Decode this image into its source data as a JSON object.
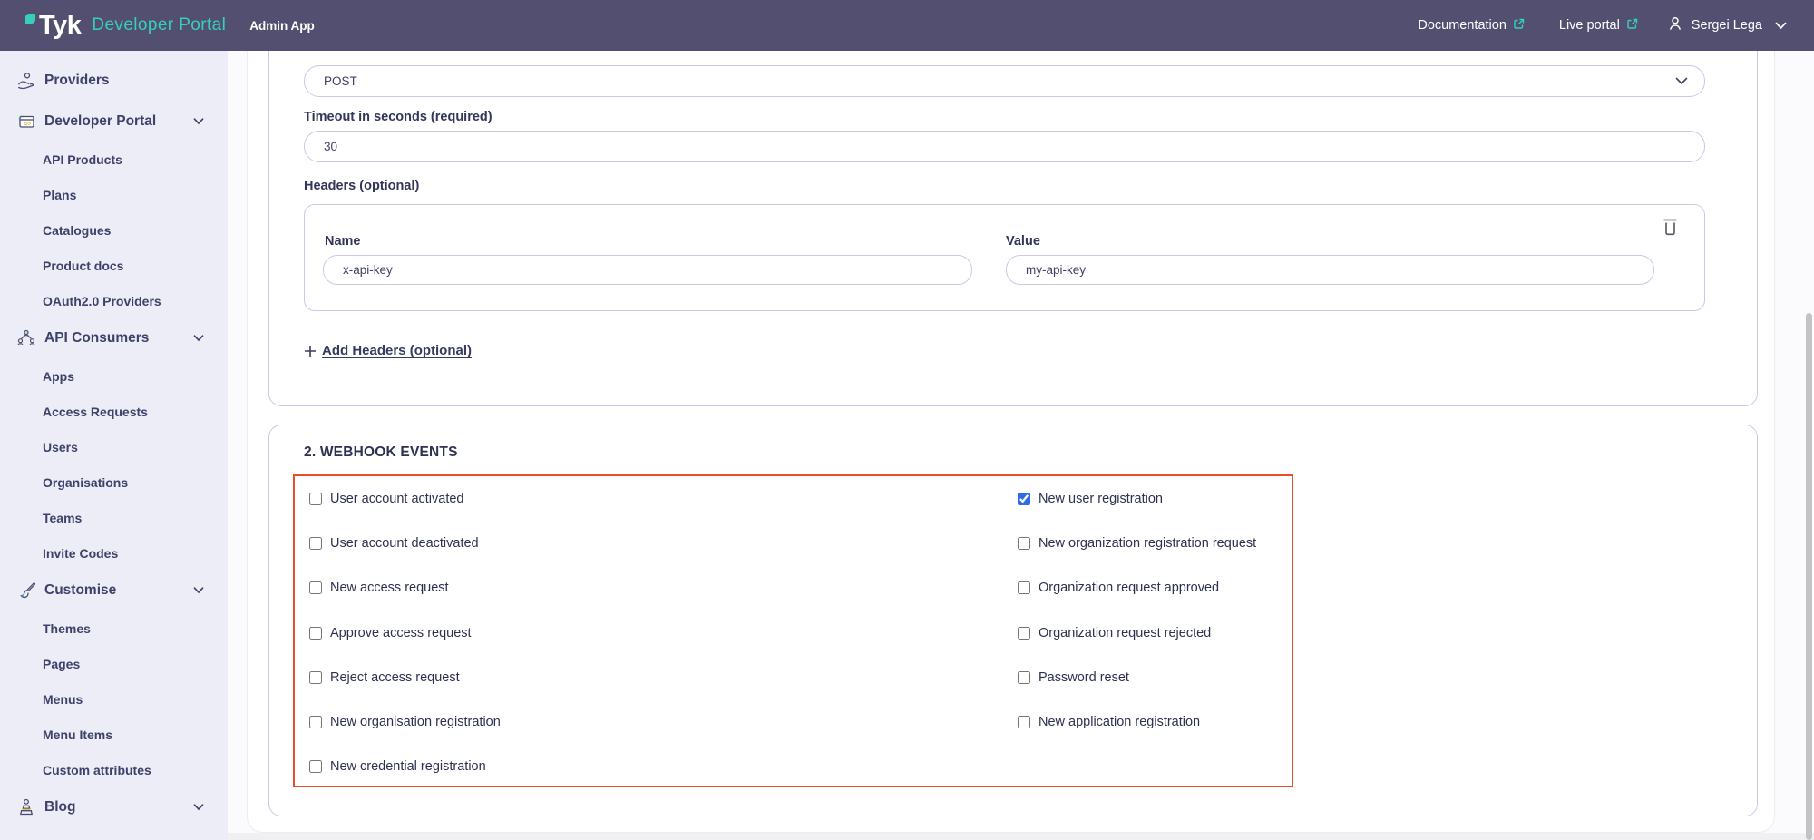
{
  "topbar": {
    "brand": "Tyk",
    "brand_suffix": "Developer Portal",
    "app_label": "Admin App",
    "links": [
      {
        "label": "Documentation",
        "icon": "external-link-icon"
      },
      {
        "label": "Live portal",
        "icon": "external-link-icon"
      }
    ],
    "user": {
      "name": "Sergei Lega"
    }
  },
  "sidebar": {
    "items": [
      {
        "label": "Providers",
        "icon": "provider-icon",
        "expandable": false,
        "children": []
      },
      {
        "label": "Developer Portal",
        "icon": "developer-portal-icon",
        "expandable": true,
        "children": [
          "API Products",
          "Plans",
          "Catalogues",
          "Product docs",
          "OAuth2.0 Providers"
        ]
      },
      {
        "label": "API Consumers",
        "icon": "api-consumers-icon",
        "expandable": true,
        "children": [
          "Apps",
          "Access Requests",
          "Users",
          "Organisations",
          "Teams",
          "Invite Codes"
        ]
      },
      {
        "label": "Customise",
        "icon": "customise-icon",
        "expandable": true,
        "children": [
          "Themes",
          "Pages",
          "Menus",
          "Menu Items",
          "Custom attributes"
        ]
      },
      {
        "label": "Blog",
        "icon": "blog-icon",
        "expandable": true,
        "children": []
      }
    ]
  },
  "form": {
    "method_select": {
      "value": "POST"
    },
    "timeout": {
      "label": "Timeout in seconds (required)",
      "value": "30"
    },
    "headers": {
      "label": "Headers (optional)",
      "row": {
        "name_label": "Name",
        "name_value": "x-api-key",
        "value_label": "Value",
        "value_value": "my-api-key"
      },
      "add_link": "Add Headers (optional)"
    }
  },
  "webhook_events": {
    "heading": "2. WEBHOOK EVENTS",
    "left_column": [
      {
        "label": "User account activated",
        "checked": false
      },
      {
        "label": "User account deactivated",
        "checked": false
      },
      {
        "label": "New access request",
        "checked": false
      },
      {
        "label": "Approve access request",
        "checked": false
      },
      {
        "label": "Reject access request",
        "checked": false
      },
      {
        "label": "New organisation registration",
        "checked": false
      },
      {
        "label": "New credential registration",
        "checked": false
      }
    ],
    "right_column": [
      {
        "label": "New user registration",
        "checked": true
      },
      {
        "label": "New organization registration request",
        "checked": false
      },
      {
        "label": "Organization request approved",
        "checked": false
      },
      {
        "label": "Organization request rejected",
        "checked": false
      },
      {
        "label": "Password reset",
        "checked": false
      },
      {
        "label": "New application registration",
        "checked": false
      }
    ]
  },
  "colors": {
    "topbar_bg": "#534f70",
    "accent_teal": "#35d0ba",
    "sidebar_bg": "#ecedf6",
    "border_purple": "#c9c8ea",
    "highlight_red": "#e84e2c",
    "checkbox_checked_blue": "#2f6be4",
    "text_navy": "#33365a"
  }
}
